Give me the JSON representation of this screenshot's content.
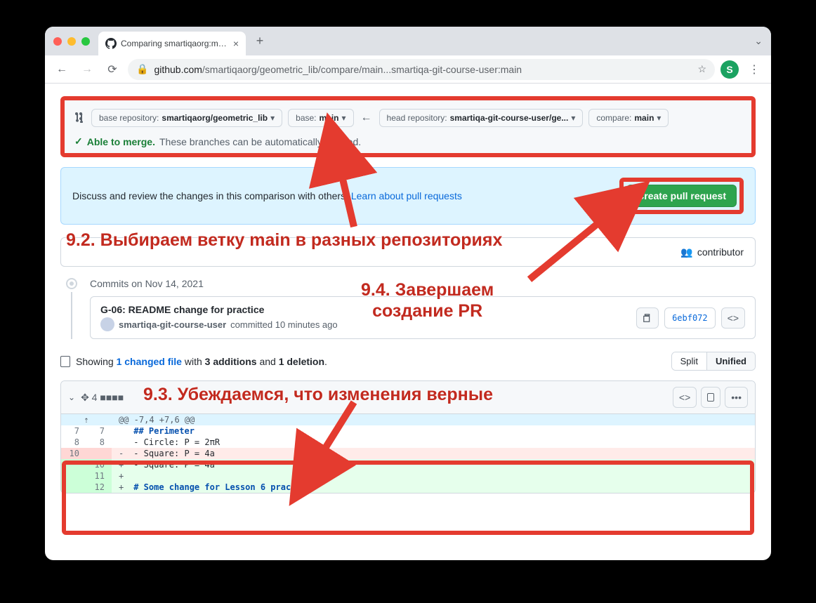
{
  "browser": {
    "tab_title": "Comparing smartiqaorg:main...",
    "url_prefix": "github.com",
    "url_path": "/smartiqaorg/geometric_lib/compare/main...smartiqa-git-course-user:main"
  },
  "compare": {
    "base_repo_label": "base repository:",
    "base_repo_value": "smartiqaorg/geometric_lib",
    "base_label": "base:",
    "base_value": "main",
    "head_repo_label": "head repository:",
    "head_repo_value": "smartiqa-git-course-user/ge...",
    "compare_label": "compare:",
    "compare_value": "main",
    "able_to_merge": "Able to merge.",
    "merge_note": "These branches can be automatically merged."
  },
  "discuss": {
    "text": "Discuss and review the changes in this comparison with others.",
    "link": "Learn about pull requests",
    "button": "Create pull request"
  },
  "contrib": {
    "label": "contributor"
  },
  "annotations": {
    "a92": "9.2. Выбираем ветку main в разных репозиториях",
    "a94": "9.4. Завершаем создание PR",
    "a93": "9.3. Убеждаемся, что изменения верные"
  },
  "commits": {
    "date": "Commits on Nov 14, 2021",
    "title": "G-06: README change for practice",
    "author": "smartiqa-git-course-user",
    "when": "committed 10 minutes ago",
    "sha": "6ebf072"
  },
  "diff_summary": {
    "showing": "Showing",
    "files": "1 changed file",
    "with": "with",
    "adds": "3 additions",
    "and": "and",
    "dels": "1 deletion",
    "split": "Split",
    "unified": "Unified"
  },
  "file": {
    "hunk": "@@ -7,4 +7,6 @@",
    "lines": [
      {
        "oldNo": "7",
        "newNo": "7",
        "type": "ctx",
        "text": "## Perimeter",
        "cls": "reg1"
      },
      {
        "oldNo": "8",
        "newNo": "8",
        "type": "ctx",
        "text": "- Circle: P = 2πR"
      },
      {
        "oldNo": "10",
        "newNo": "",
        "type": "del",
        "text": "- Square: P = 4a"
      },
      {
        "oldNo": "",
        "newNo": "10",
        "type": "add",
        "text": "- Square: P = 4a"
      },
      {
        "oldNo": "",
        "newNo": "11",
        "type": "add",
        "text": ""
      },
      {
        "oldNo": "",
        "newNo": "12",
        "type": "add",
        "text": "# Some change for Lesson 6 practice",
        "cls": "reg1"
      }
    ]
  }
}
